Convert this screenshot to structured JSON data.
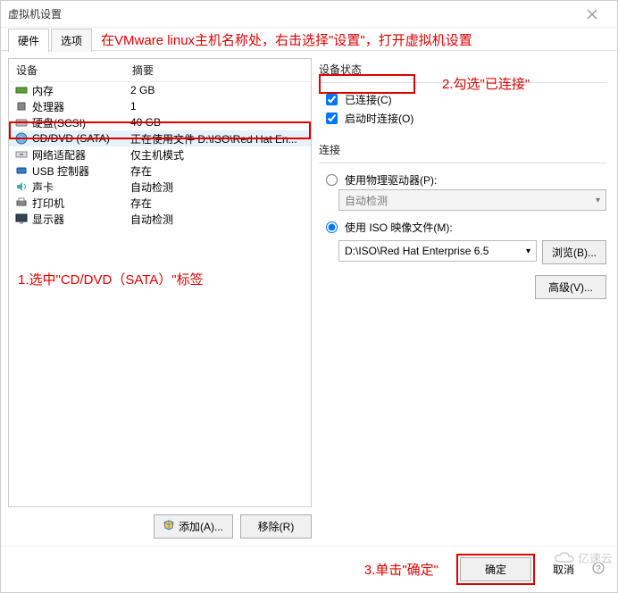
{
  "window": {
    "title": "虚拟机设置"
  },
  "tabs": {
    "hardware": "硬件",
    "options": "选项"
  },
  "annotations": {
    "top": "在VMware linux主机名称处，右击选择\"设置\"，打开虚拟机设置",
    "step1": "1.选中\"CD/DVD（SATA）\"标签",
    "step2": "2.勾选\"已连接\"",
    "step3": "3.单击\"确定\""
  },
  "hw": {
    "header_device": "设备",
    "header_summary": "摘要",
    "rows": [
      {
        "icon": "memory",
        "device": "内存",
        "summary": "2 GB"
      },
      {
        "icon": "cpu",
        "device": "处理器",
        "summary": "1"
      },
      {
        "icon": "disk",
        "device": "硬盘(SCSI)",
        "summary": "40 GB"
      },
      {
        "icon": "cd",
        "device": "CD/DVD (SATA)",
        "summary": "正在使用文件 D:\\ISO\\Red Hat En..."
      },
      {
        "icon": "net",
        "device": "网络适配器",
        "summary": "仅主机模式"
      },
      {
        "icon": "usb",
        "device": "USB 控制器",
        "summary": "存在"
      },
      {
        "icon": "sound",
        "device": "声卡",
        "summary": "自动检测"
      },
      {
        "icon": "printer",
        "device": "打印机",
        "summary": "存在"
      },
      {
        "icon": "display",
        "device": "显示器",
        "summary": "自动检测"
      }
    ]
  },
  "left_buttons": {
    "add": "添加(A)...",
    "remove": "移除(R)"
  },
  "right": {
    "status_title": "设备状态",
    "connected": "已连接(C)",
    "connect_at_poweron": "启动时连接(O)",
    "connection_title": "连接",
    "use_physical": "使用物理驱动器(P):",
    "auto_detect": "自动检测",
    "use_iso": "使用 ISO 映像文件(M):",
    "iso_path": "D:\\ISO\\Red Hat Enterprise 6.5",
    "browse": "浏览(B)...",
    "advanced": "高级(V)..."
  },
  "footer": {
    "ok": "确定",
    "cancel": "取消"
  },
  "watermark": "亿速云"
}
